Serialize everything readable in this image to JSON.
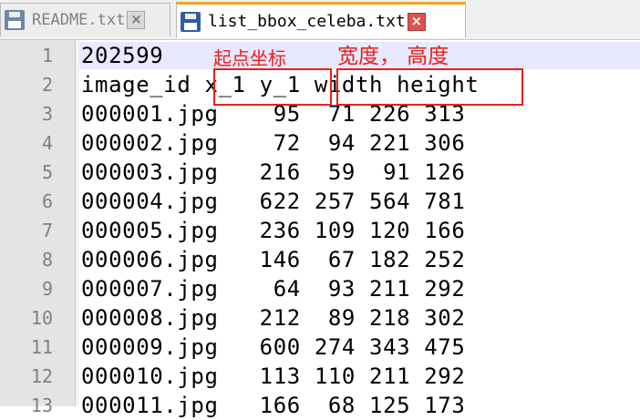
{
  "tabs": [
    {
      "label": "README.txt",
      "active": false
    },
    {
      "label": "list_bbox_celeba.txt",
      "active": true
    }
  ],
  "lines": [
    {
      "num": "1",
      "text": "202599"
    },
    {
      "num": "2",
      "text": "image_id x_1 y_1 width height"
    },
    {
      "num": "3",
      "text": "000001.jpg    95  71 226 313"
    },
    {
      "num": "4",
      "text": "000002.jpg    72  94 221 306"
    },
    {
      "num": "5",
      "text": "000003.jpg   216  59  91 126"
    },
    {
      "num": "6",
      "text": "000004.jpg   622 257 564 781"
    },
    {
      "num": "7",
      "text": "000005.jpg   236 109 120 166"
    },
    {
      "num": "8",
      "text": "000006.jpg   146  67 182 252"
    },
    {
      "num": "9",
      "text": "000007.jpg    64  93 211 292"
    },
    {
      "num": "10",
      "text": "000008.jpg   212  89 218 302"
    },
    {
      "num": "11",
      "text": "000009.jpg   600 274 343 475"
    },
    {
      "num": "12",
      "text": "000010.jpg   113 110 211 292"
    },
    {
      "num": "13",
      "text": "000011.jpg   166  68 125 173"
    }
  ],
  "annotations": {
    "start_coord": "起点坐标",
    "width_height": "宽度， 高度"
  },
  "colors": {
    "annotation": "#e8201a",
    "current_line": "#e8e8ff",
    "active_tab_accent": "#f5a623"
  }
}
